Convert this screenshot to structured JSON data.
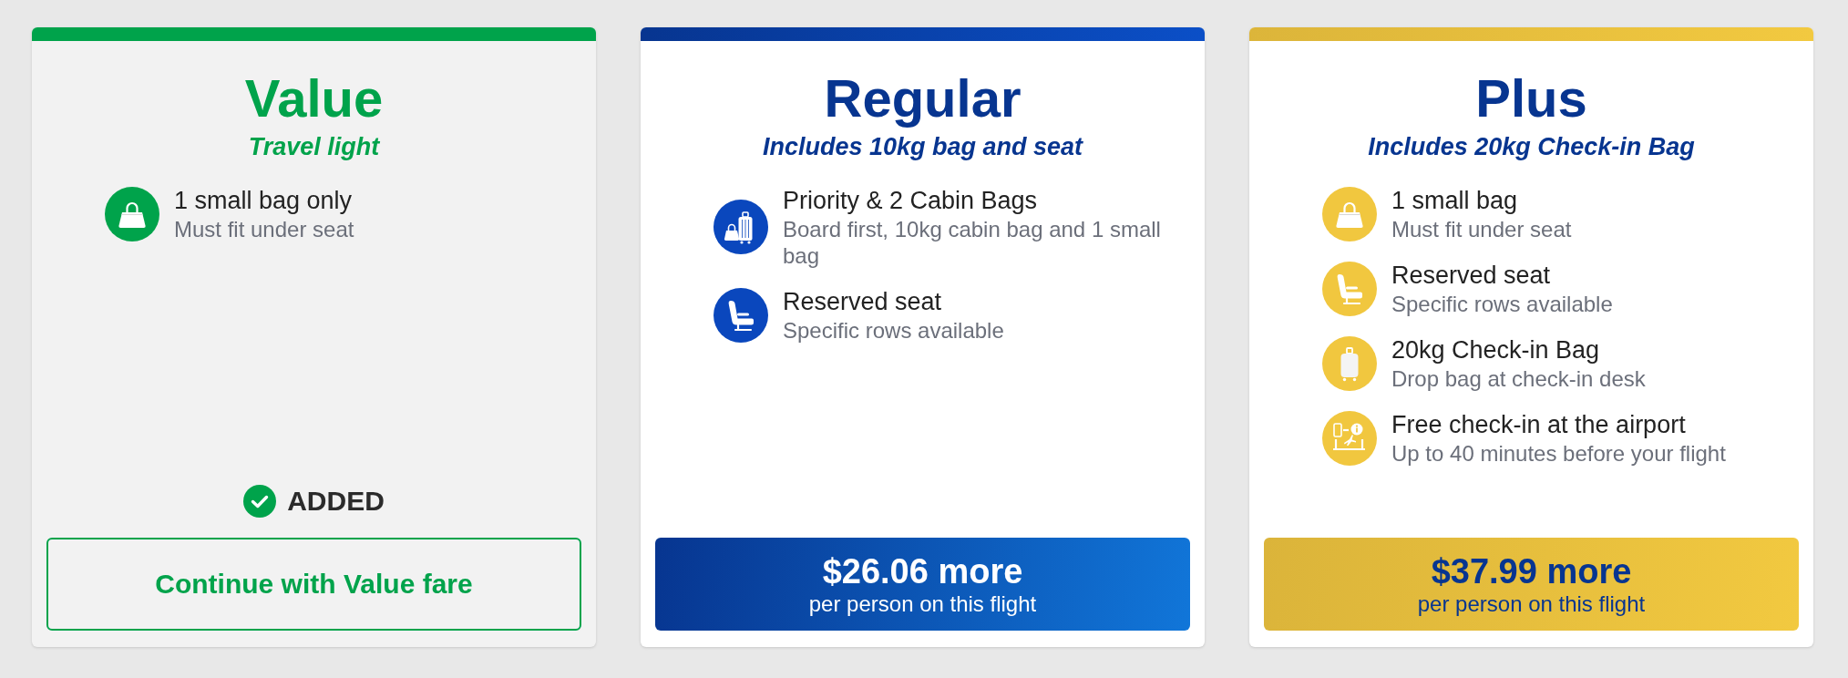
{
  "fares": [
    {
      "kind": "value",
      "selected": true,
      "name": "Value",
      "tagline": "Travel light",
      "features": [
        {
          "kind": "handbag",
          "title": "1 small bag only",
          "detail": "Must fit under seat"
        }
      ],
      "status": "ADDED",
      "button": {
        "label": "Continue with Value fare"
      }
    },
    {
      "kind": "regular",
      "selected": false,
      "name": "Regular",
      "tagline": "Includes 10kg bag and seat",
      "features": [
        {
          "kind": "cabin-bags",
          "title": "Priority & 2 Cabin Bags",
          "detail": "Board first, 10kg cabin bag and 1 small bag"
        },
        {
          "kind": "seat",
          "title": "Reserved seat",
          "detail": "Specific rows available"
        }
      ],
      "button": {
        "label": "$26.06 more",
        "note": "per person on this flight"
      }
    },
    {
      "kind": "plus",
      "selected": false,
      "name": "Plus",
      "tagline": "Includes 20kg Check-in Bag",
      "features": [
        {
          "kind": "handbag",
          "title": "1 small bag",
          "detail": "Must fit under seat"
        },
        {
          "kind": "seat",
          "title": "Reserved seat",
          "detail": "Specific rows available"
        },
        {
          "kind": "suitcase",
          "title": "20kg Check-in Bag",
          "detail": "Drop bag at check-in desk"
        },
        {
          "kind": "checkin-desk",
          "title": "Free check-in at the airport",
          "detail": "Up to 40 minutes before your flight"
        }
      ],
      "button": {
        "label": "$37.99 more",
        "note": "per person on this flight"
      }
    }
  ]
}
